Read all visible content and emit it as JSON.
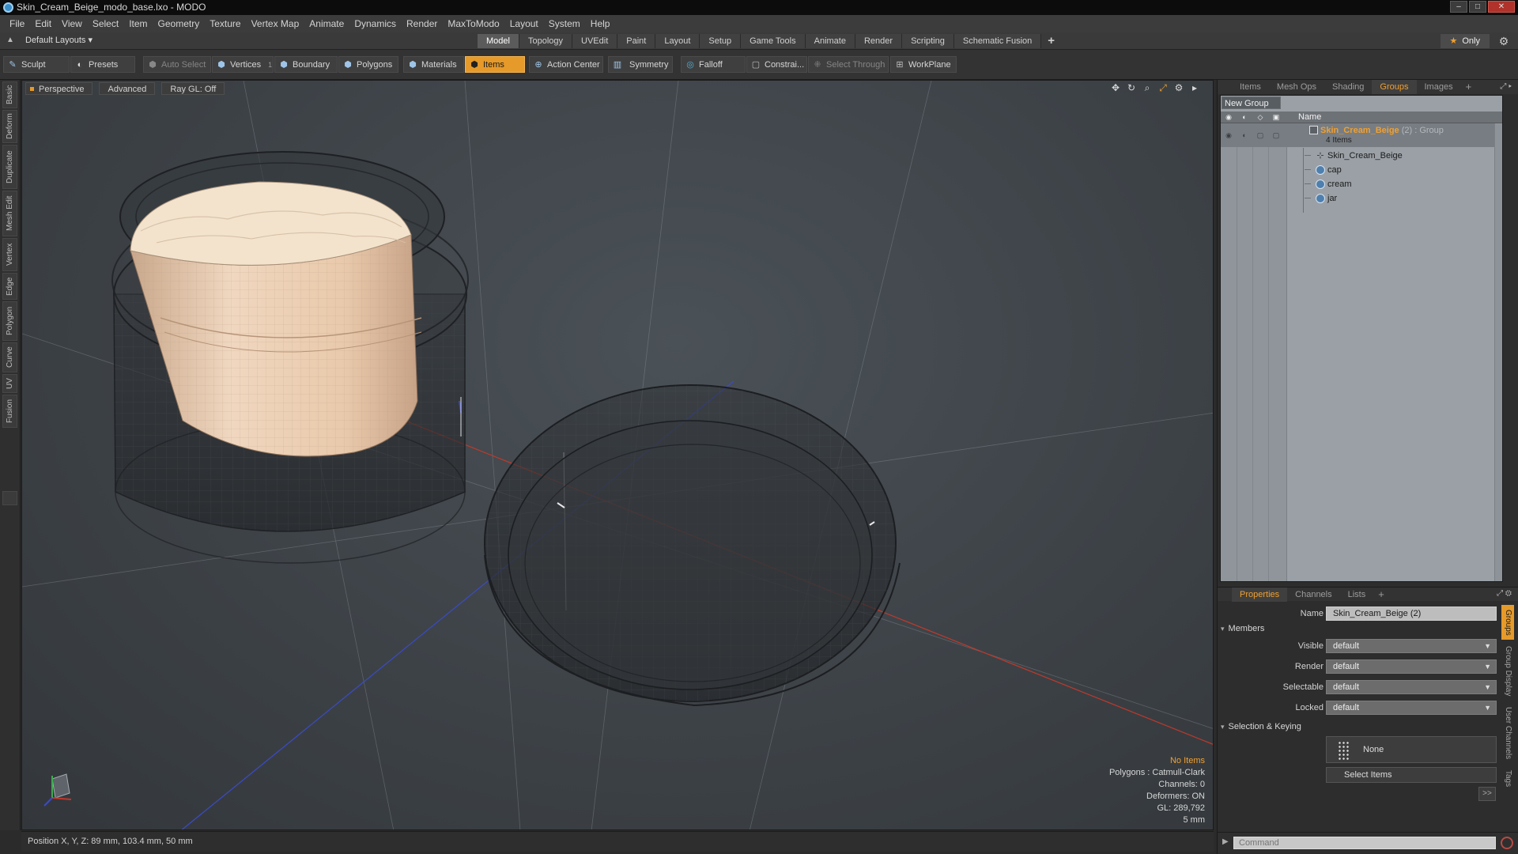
{
  "window": {
    "title": "Skin_Cream_Beige_modo_base.lxo - MODO",
    "buttons": {
      "minimize": "–",
      "maximize": "□",
      "close": "✕"
    }
  },
  "menu": [
    "File",
    "Edit",
    "View",
    "Select",
    "Item",
    "Geometry",
    "Texture",
    "Vertex Map",
    "Animate",
    "Dynamics",
    "Render",
    "MaxToModo",
    "Layout",
    "System",
    "Help"
  ],
  "layout_bar": {
    "layouts_label": "Default Layouts ▾",
    "tabs": [
      "Model",
      "Topology",
      "UVEdit",
      "Paint",
      "Layout",
      "Setup",
      "Game Tools",
      "Animate",
      "Render",
      "Scripting",
      "Schematic Fusion"
    ],
    "active_tab": "Model",
    "add_tab": "+",
    "only_label": "Only"
  },
  "toolbar": {
    "sculpt": "Sculpt",
    "presets": "Presets",
    "auto_select": "Auto Select",
    "vertices": "Vertices",
    "vertices_count": "1",
    "boundary": "Boundary",
    "polygons": "Polygons",
    "materials": "Materials",
    "items": "Items",
    "action_center": "Action Center",
    "symmetry": "Symmetry",
    "falloff": "Falloff",
    "constraints": "Constrai...",
    "select_through": "Select Through",
    "workplane": "WorkPlane"
  },
  "left_tabs": [
    "Basic",
    "Deform",
    "Duplicate",
    "Mesh Edit",
    "Vertex",
    "Edge",
    "Polygon",
    "Curve",
    "UV",
    "Fusion"
  ],
  "viewport": {
    "view_mode": "Perspective",
    "shading": "Advanced",
    "raygl": "Ray GL: Off",
    "info": {
      "selection": "No Items",
      "polygons": "Polygons : Catmull-Clark",
      "channels": "Channels: 0",
      "deformers": "Deformers: ON",
      "gl": "GL: 289,792",
      "scale": "5 mm"
    }
  },
  "status": {
    "position": "Position X, Y, Z:  89 mm, 103.4 mm, 50 mm"
  },
  "right_panel": {
    "tabs": [
      "Items",
      "Mesh Ops",
      "Shading",
      "Groups",
      "Images"
    ],
    "active_tab": "Groups",
    "add_tab": "+",
    "new_group": "New Group",
    "name_header": "Name",
    "group": {
      "name": "Skin_Cream_Beige",
      "suffix": " (2) : Group",
      "count": "4 Items"
    },
    "children": [
      "Skin_Cream_Beige",
      "cap",
      "cream",
      "jar"
    ]
  },
  "properties": {
    "tabs": [
      "Properties",
      "Channels",
      "Lists"
    ],
    "active_tab": "Properties",
    "add_tab": "+",
    "name_label": "Name",
    "name_value": "Skin_Cream_Beige (2)",
    "members_section": "Members",
    "visible_label": "Visible",
    "visible_value": "default",
    "render_label": "Render",
    "render_value": "default",
    "selectable_label": "Selectable",
    "selectable_value": "default",
    "locked_label": "Locked",
    "locked_value": "default",
    "keying_section": "Selection & Keying",
    "none_label": "None",
    "select_items": "Select Items",
    "more": ">>",
    "side_tabs": [
      "Groups",
      "Group Display",
      "User Channels",
      "Tags"
    ]
  },
  "command": {
    "placeholder": "Command"
  },
  "colors": {
    "accent": "#e69a2a",
    "group_name": "#f0a030",
    "cream": "#e8c9a8",
    "x_axis": "#c0392b",
    "z_axis": "#3b4bc8"
  }
}
